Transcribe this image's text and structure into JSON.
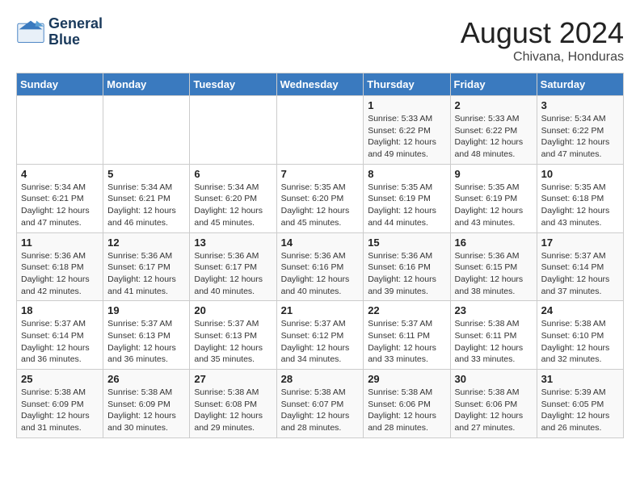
{
  "header": {
    "logo_line1": "General",
    "logo_line2": "Blue",
    "month_title": "August 2024",
    "subtitle": "Chivana, Honduras"
  },
  "days_of_week": [
    "Sunday",
    "Monday",
    "Tuesday",
    "Wednesday",
    "Thursday",
    "Friday",
    "Saturday"
  ],
  "weeks": [
    [
      {
        "day": "",
        "info": ""
      },
      {
        "day": "",
        "info": ""
      },
      {
        "day": "",
        "info": ""
      },
      {
        "day": "",
        "info": ""
      },
      {
        "day": "1",
        "info": "Sunrise: 5:33 AM\nSunset: 6:22 PM\nDaylight: 12 hours\nand 49 minutes."
      },
      {
        "day": "2",
        "info": "Sunrise: 5:33 AM\nSunset: 6:22 PM\nDaylight: 12 hours\nand 48 minutes."
      },
      {
        "day": "3",
        "info": "Sunrise: 5:34 AM\nSunset: 6:22 PM\nDaylight: 12 hours\nand 47 minutes."
      }
    ],
    [
      {
        "day": "4",
        "info": "Sunrise: 5:34 AM\nSunset: 6:21 PM\nDaylight: 12 hours\nand 47 minutes."
      },
      {
        "day": "5",
        "info": "Sunrise: 5:34 AM\nSunset: 6:21 PM\nDaylight: 12 hours\nand 46 minutes."
      },
      {
        "day": "6",
        "info": "Sunrise: 5:34 AM\nSunset: 6:20 PM\nDaylight: 12 hours\nand 45 minutes."
      },
      {
        "day": "7",
        "info": "Sunrise: 5:35 AM\nSunset: 6:20 PM\nDaylight: 12 hours\nand 45 minutes."
      },
      {
        "day": "8",
        "info": "Sunrise: 5:35 AM\nSunset: 6:19 PM\nDaylight: 12 hours\nand 44 minutes."
      },
      {
        "day": "9",
        "info": "Sunrise: 5:35 AM\nSunset: 6:19 PM\nDaylight: 12 hours\nand 43 minutes."
      },
      {
        "day": "10",
        "info": "Sunrise: 5:35 AM\nSunset: 6:18 PM\nDaylight: 12 hours\nand 43 minutes."
      }
    ],
    [
      {
        "day": "11",
        "info": "Sunrise: 5:36 AM\nSunset: 6:18 PM\nDaylight: 12 hours\nand 42 minutes."
      },
      {
        "day": "12",
        "info": "Sunrise: 5:36 AM\nSunset: 6:17 PM\nDaylight: 12 hours\nand 41 minutes."
      },
      {
        "day": "13",
        "info": "Sunrise: 5:36 AM\nSunset: 6:17 PM\nDaylight: 12 hours\nand 40 minutes."
      },
      {
        "day": "14",
        "info": "Sunrise: 5:36 AM\nSunset: 6:16 PM\nDaylight: 12 hours\nand 40 minutes."
      },
      {
        "day": "15",
        "info": "Sunrise: 5:36 AM\nSunset: 6:16 PM\nDaylight: 12 hours\nand 39 minutes."
      },
      {
        "day": "16",
        "info": "Sunrise: 5:36 AM\nSunset: 6:15 PM\nDaylight: 12 hours\nand 38 minutes."
      },
      {
        "day": "17",
        "info": "Sunrise: 5:37 AM\nSunset: 6:14 PM\nDaylight: 12 hours\nand 37 minutes."
      }
    ],
    [
      {
        "day": "18",
        "info": "Sunrise: 5:37 AM\nSunset: 6:14 PM\nDaylight: 12 hours\nand 36 minutes."
      },
      {
        "day": "19",
        "info": "Sunrise: 5:37 AM\nSunset: 6:13 PM\nDaylight: 12 hours\nand 36 minutes."
      },
      {
        "day": "20",
        "info": "Sunrise: 5:37 AM\nSunset: 6:13 PM\nDaylight: 12 hours\nand 35 minutes."
      },
      {
        "day": "21",
        "info": "Sunrise: 5:37 AM\nSunset: 6:12 PM\nDaylight: 12 hours\nand 34 minutes."
      },
      {
        "day": "22",
        "info": "Sunrise: 5:37 AM\nSunset: 6:11 PM\nDaylight: 12 hours\nand 33 minutes."
      },
      {
        "day": "23",
        "info": "Sunrise: 5:38 AM\nSunset: 6:11 PM\nDaylight: 12 hours\nand 33 minutes."
      },
      {
        "day": "24",
        "info": "Sunrise: 5:38 AM\nSunset: 6:10 PM\nDaylight: 12 hours\nand 32 minutes."
      }
    ],
    [
      {
        "day": "25",
        "info": "Sunrise: 5:38 AM\nSunset: 6:09 PM\nDaylight: 12 hours\nand 31 minutes."
      },
      {
        "day": "26",
        "info": "Sunrise: 5:38 AM\nSunset: 6:09 PM\nDaylight: 12 hours\nand 30 minutes."
      },
      {
        "day": "27",
        "info": "Sunrise: 5:38 AM\nSunset: 6:08 PM\nDaylight: 12 hours\nand 29 minutes."
      },
      {
        "day": "28",
        "info": "Sunrise: 5:38 AM\nSunset: 6:07 PM\nDaylight: 12 hours\nand 28 minutes."
      },
      {
        "day": "29",
        "info": "Sunrise: 5:38 AM\nSunset: 6:06 PM\nDaylight: 12 hours\nand 28 minutes."
      },
      {
        "day": "30",
        "info": "Sunrise: 5:38 AM\nSunset: 6:06 PM\nDaylight: 12 hours\nand 27 minutes."
      },
      {
        "day": "31",
        "info": "Sunrise: 5:39 AM\nSunset: 6:05 PM\nDaylight: 12 hours\nand 26 minutes."
      }
    ]
  ]
}
